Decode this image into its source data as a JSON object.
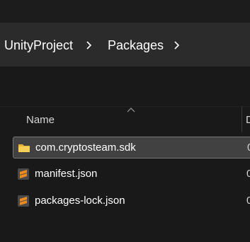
{
  "breadcrumb": {
    "items": [
      {
        "label": "UnityProject"
      },
      {
        "label": "Packages"
      }
    ]
  },
  "columns": {
    "name": "Name",
    "date_modified": "D"
  },
  "files": [
    {
      "name": "com.cryptosteam.sdk",
      "type_icon": "folder-icon",
      "date_fragment": "0",
      "selected": true
    },
    {
      "name": "manifest.json",
      "type_icon": "sublime-text-file-icon",
      "date_fragment": "0",
      "selected": false
    },
    {
      "name": "packages-lock.json",
      "type_icon": "sublime-text-file-icon",
      "date_fragment": "0",
      "selected": false
    }
  ],
  "colors": {
    "background": "#191919",
    "address_bar": "#2b2b2b",
    "selection": "#414141",
    "selection_border": "#777777",
    "folder": "#f2c44d",
    "sublime_orange": "#f08c1d"
  }
}
